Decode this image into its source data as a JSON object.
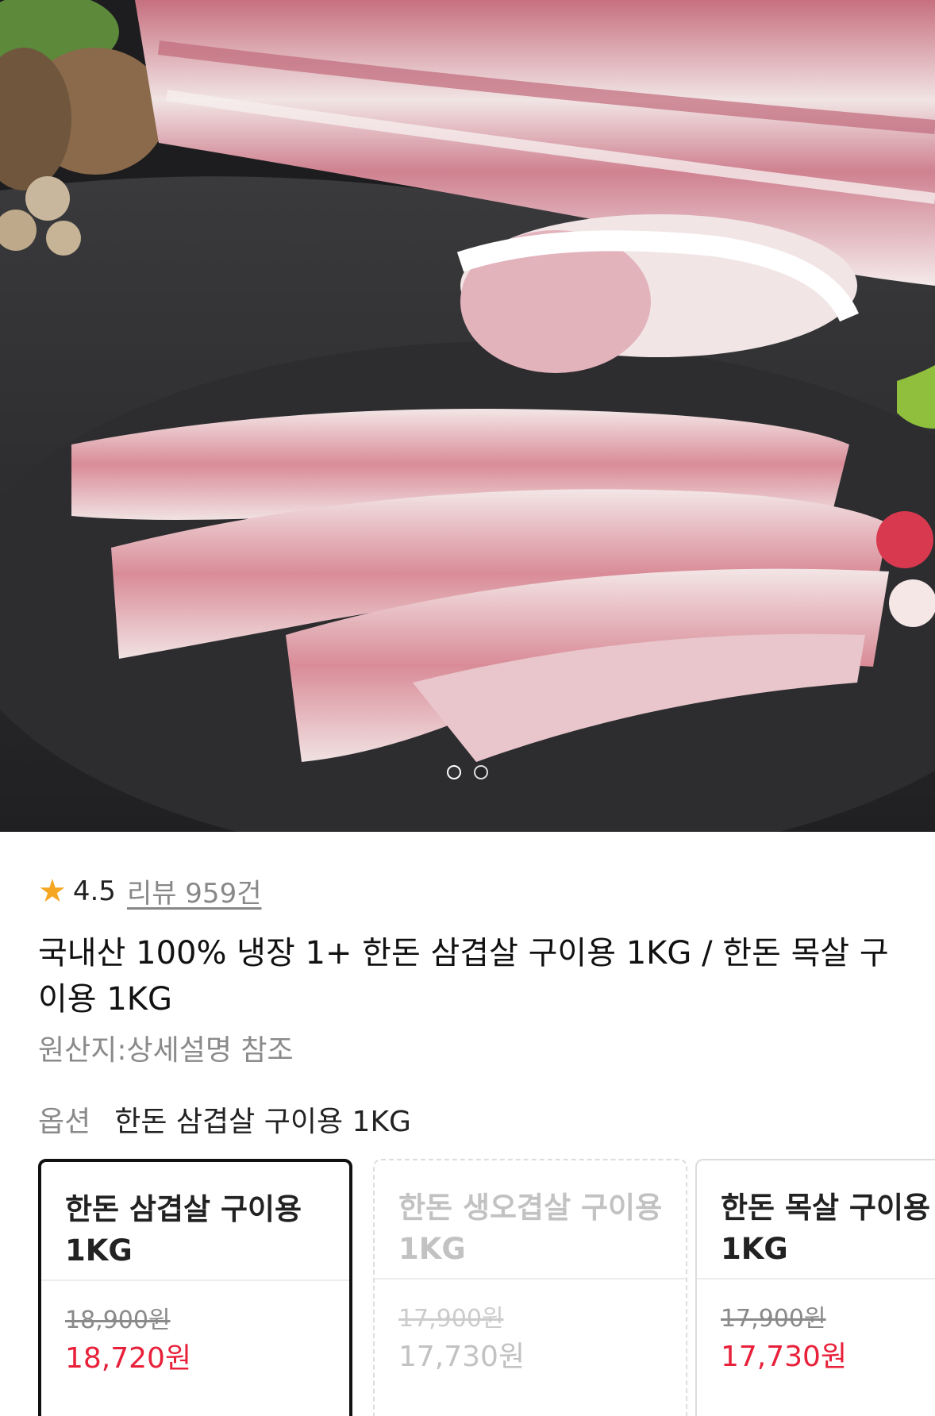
{
  "hero": {
    "image_description": "",
    "page_indicator": {
      "count": 2,
      "active": 1
    }
  },
  "rating": {
    "icon": "star-icon",
    "value": "4.5",
    "reviews": "리뷰 959건"
  },
  "product": {
    "title": "국내산 100% 냉장 1+ 한돈 삼겹살 구이용 1KG / 한돈 목살 구이용 1KG",
    "origin": "원산지:상세설명 참조"
  },
  "option": {
    "label": "옵션",
    "selected_value": "한돈 삼겹살 구이용 1KG"
  },
  "options": [
    {
      "name": "한돈 삼겹살 구이용 1KG",
      "original_price": "18,900원",
      "sale_price": "18,720원",
      "state": "selected"
    },
    {
      "name": "한돈 생오겹살 구이용 1KG",
      "original_price": "17,900원",
      "sale_price": "17,730원",
      "state": "soldout"
    },
    {
      "name": "한돈 목살 구이용 1KG",
      "original_price": "17,900원",
      "sale_price": "17,730원",
      "state": "normal"
    }
  ],
  "colors": {
    "accent_red": "#e8203a",
    "star": "#f5a623",
    "muted": "#8a8a8a"
  }
}
